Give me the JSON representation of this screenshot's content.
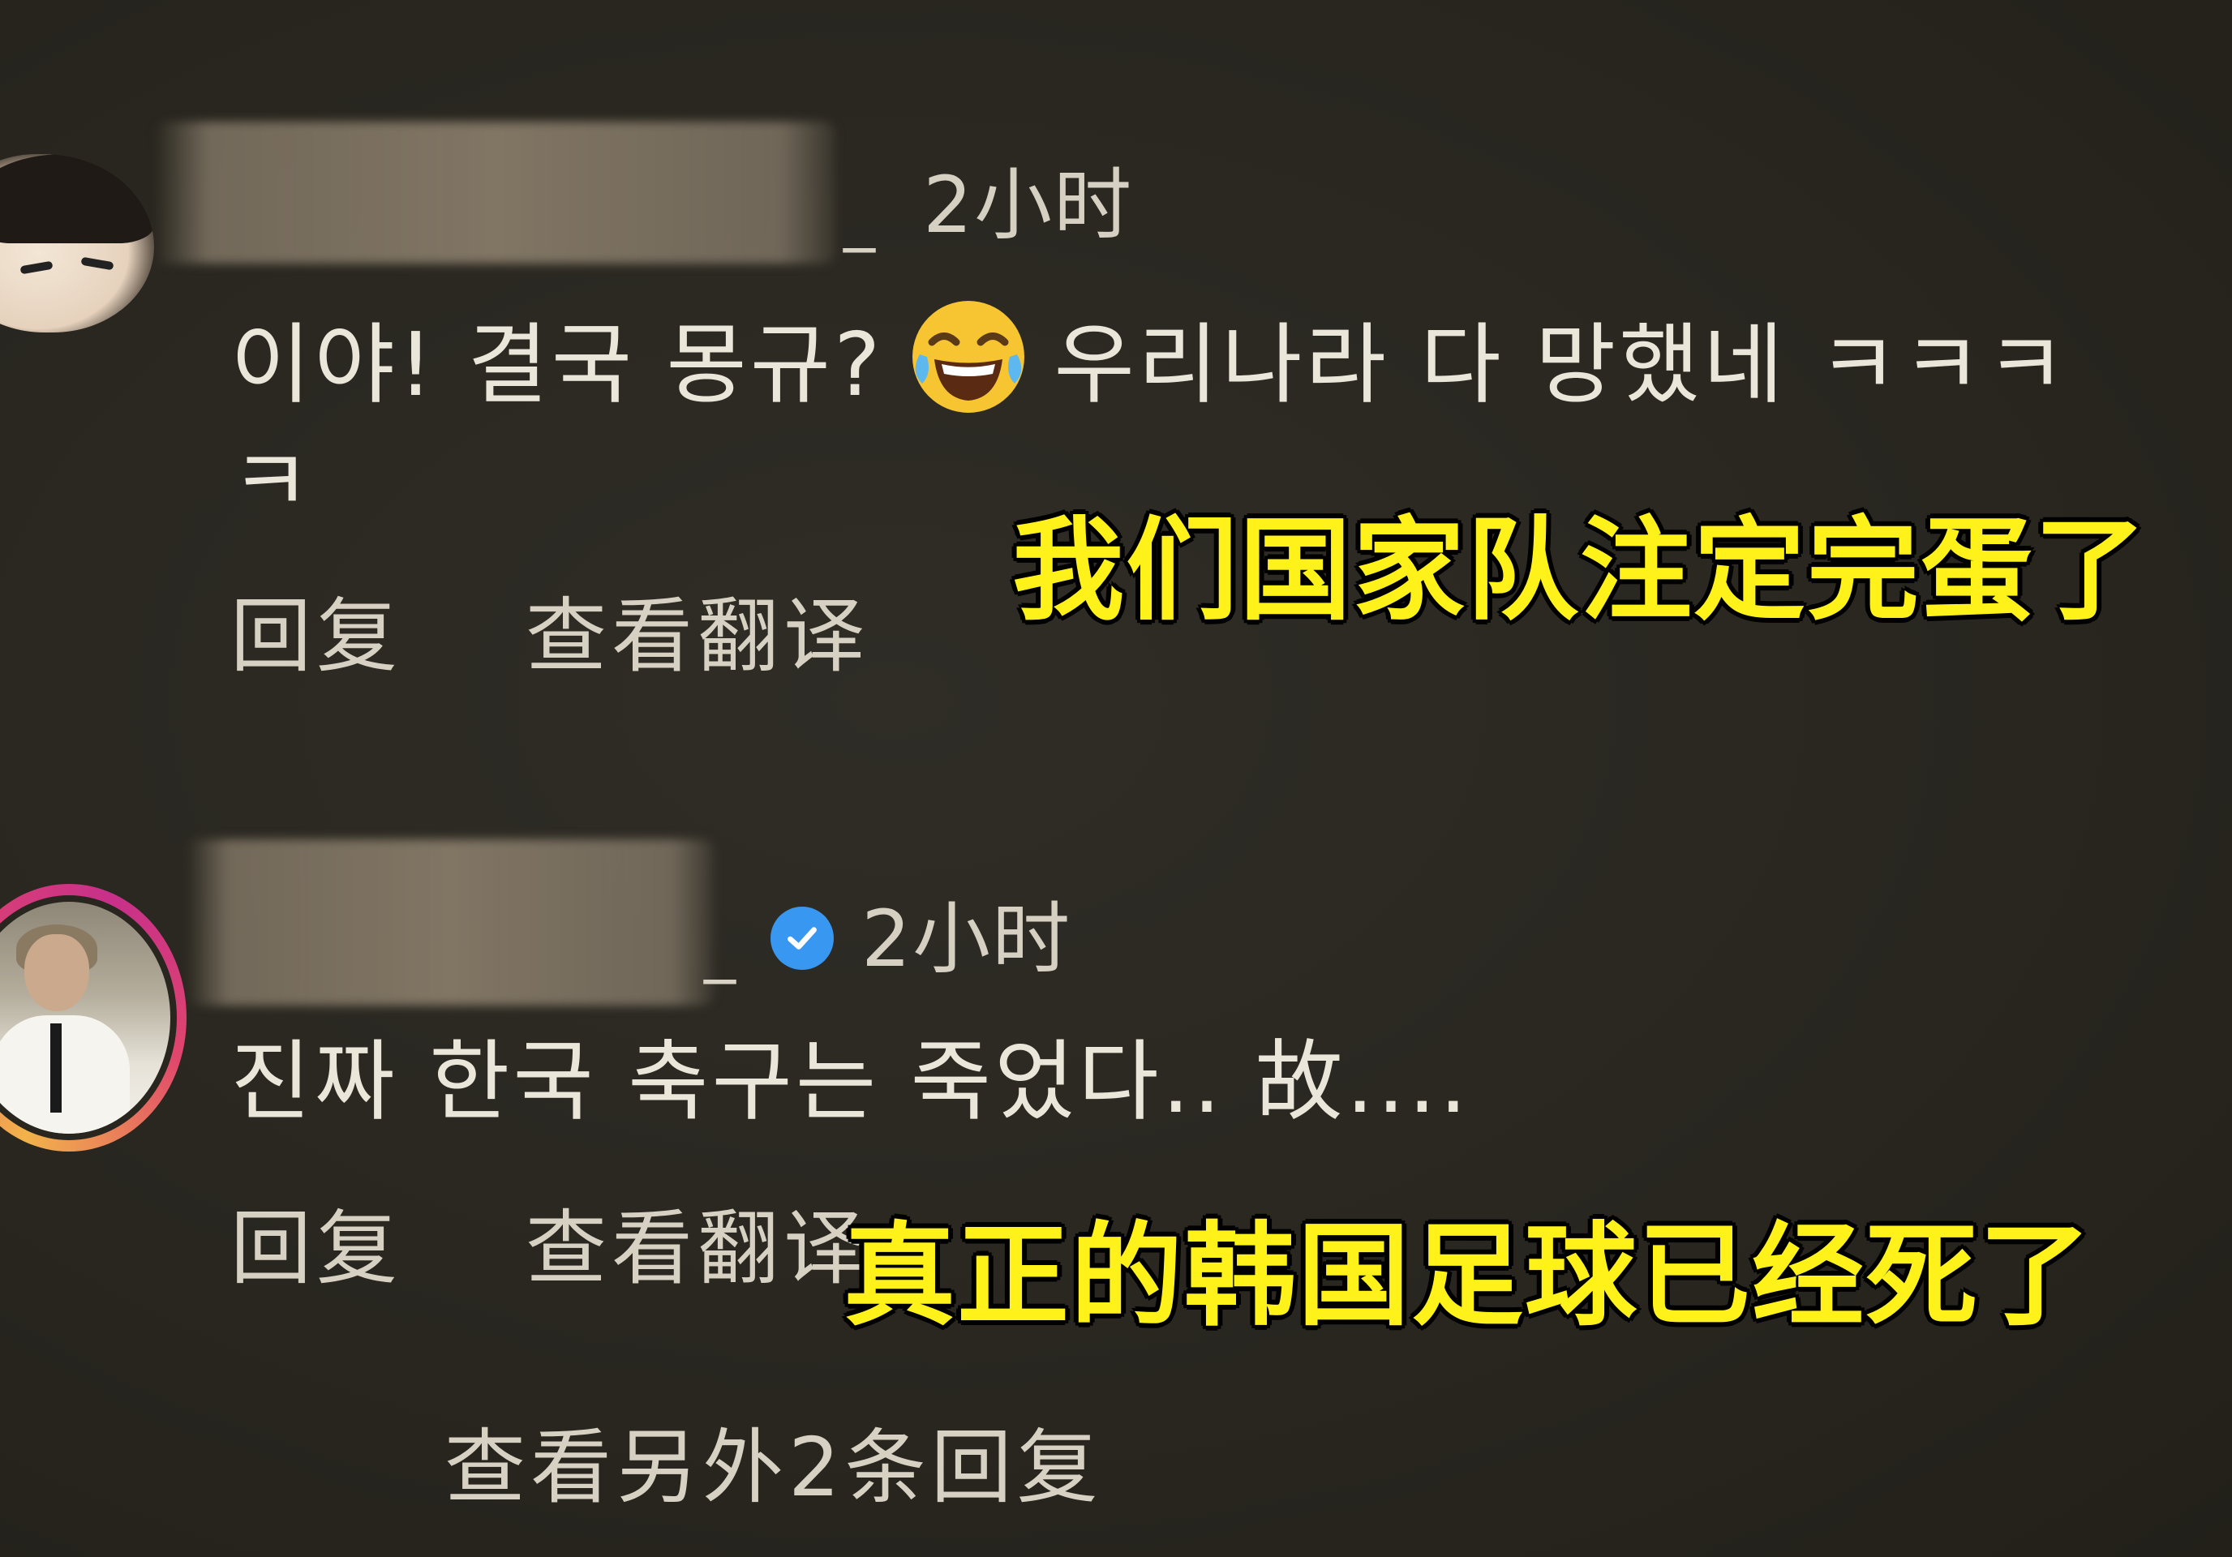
{
  "comments": [
    {
      "time": "2小时",
      "underscore": "_",
      "text_line1_before_emoji": "이야! 결국 몽규?",
      "emoji": "face-with-tears-of-joy",
      "text_line1_after_emoji": "우리나라 다 망했네 ㅋㅋㅋ",
      "text_line2": "ㅋ",
      "reply_label": "回复",
      "translate_label": "查看翻译",
      "caption": "我们国家队注定完蛋了"
    },
    {
      "time": "2小时",
      "underscore": "_",
      "verified": true,
      "text": "진짜 한국 축구는 죽었다.. 故....",
      "reply_label": "回复",
      "translate_label": "查看翻译",
      "caption": "真正的韩国足球已经死了"
    }
  ],
  "more_replies_label": "查看另外2条回复",
  "colors": {
    "background": "#2a2821",
    "caption_yellow": "#fff21a",
    "verified_blue": "#3897f0",
    "story_ring": "#e0466c"
  }
}
